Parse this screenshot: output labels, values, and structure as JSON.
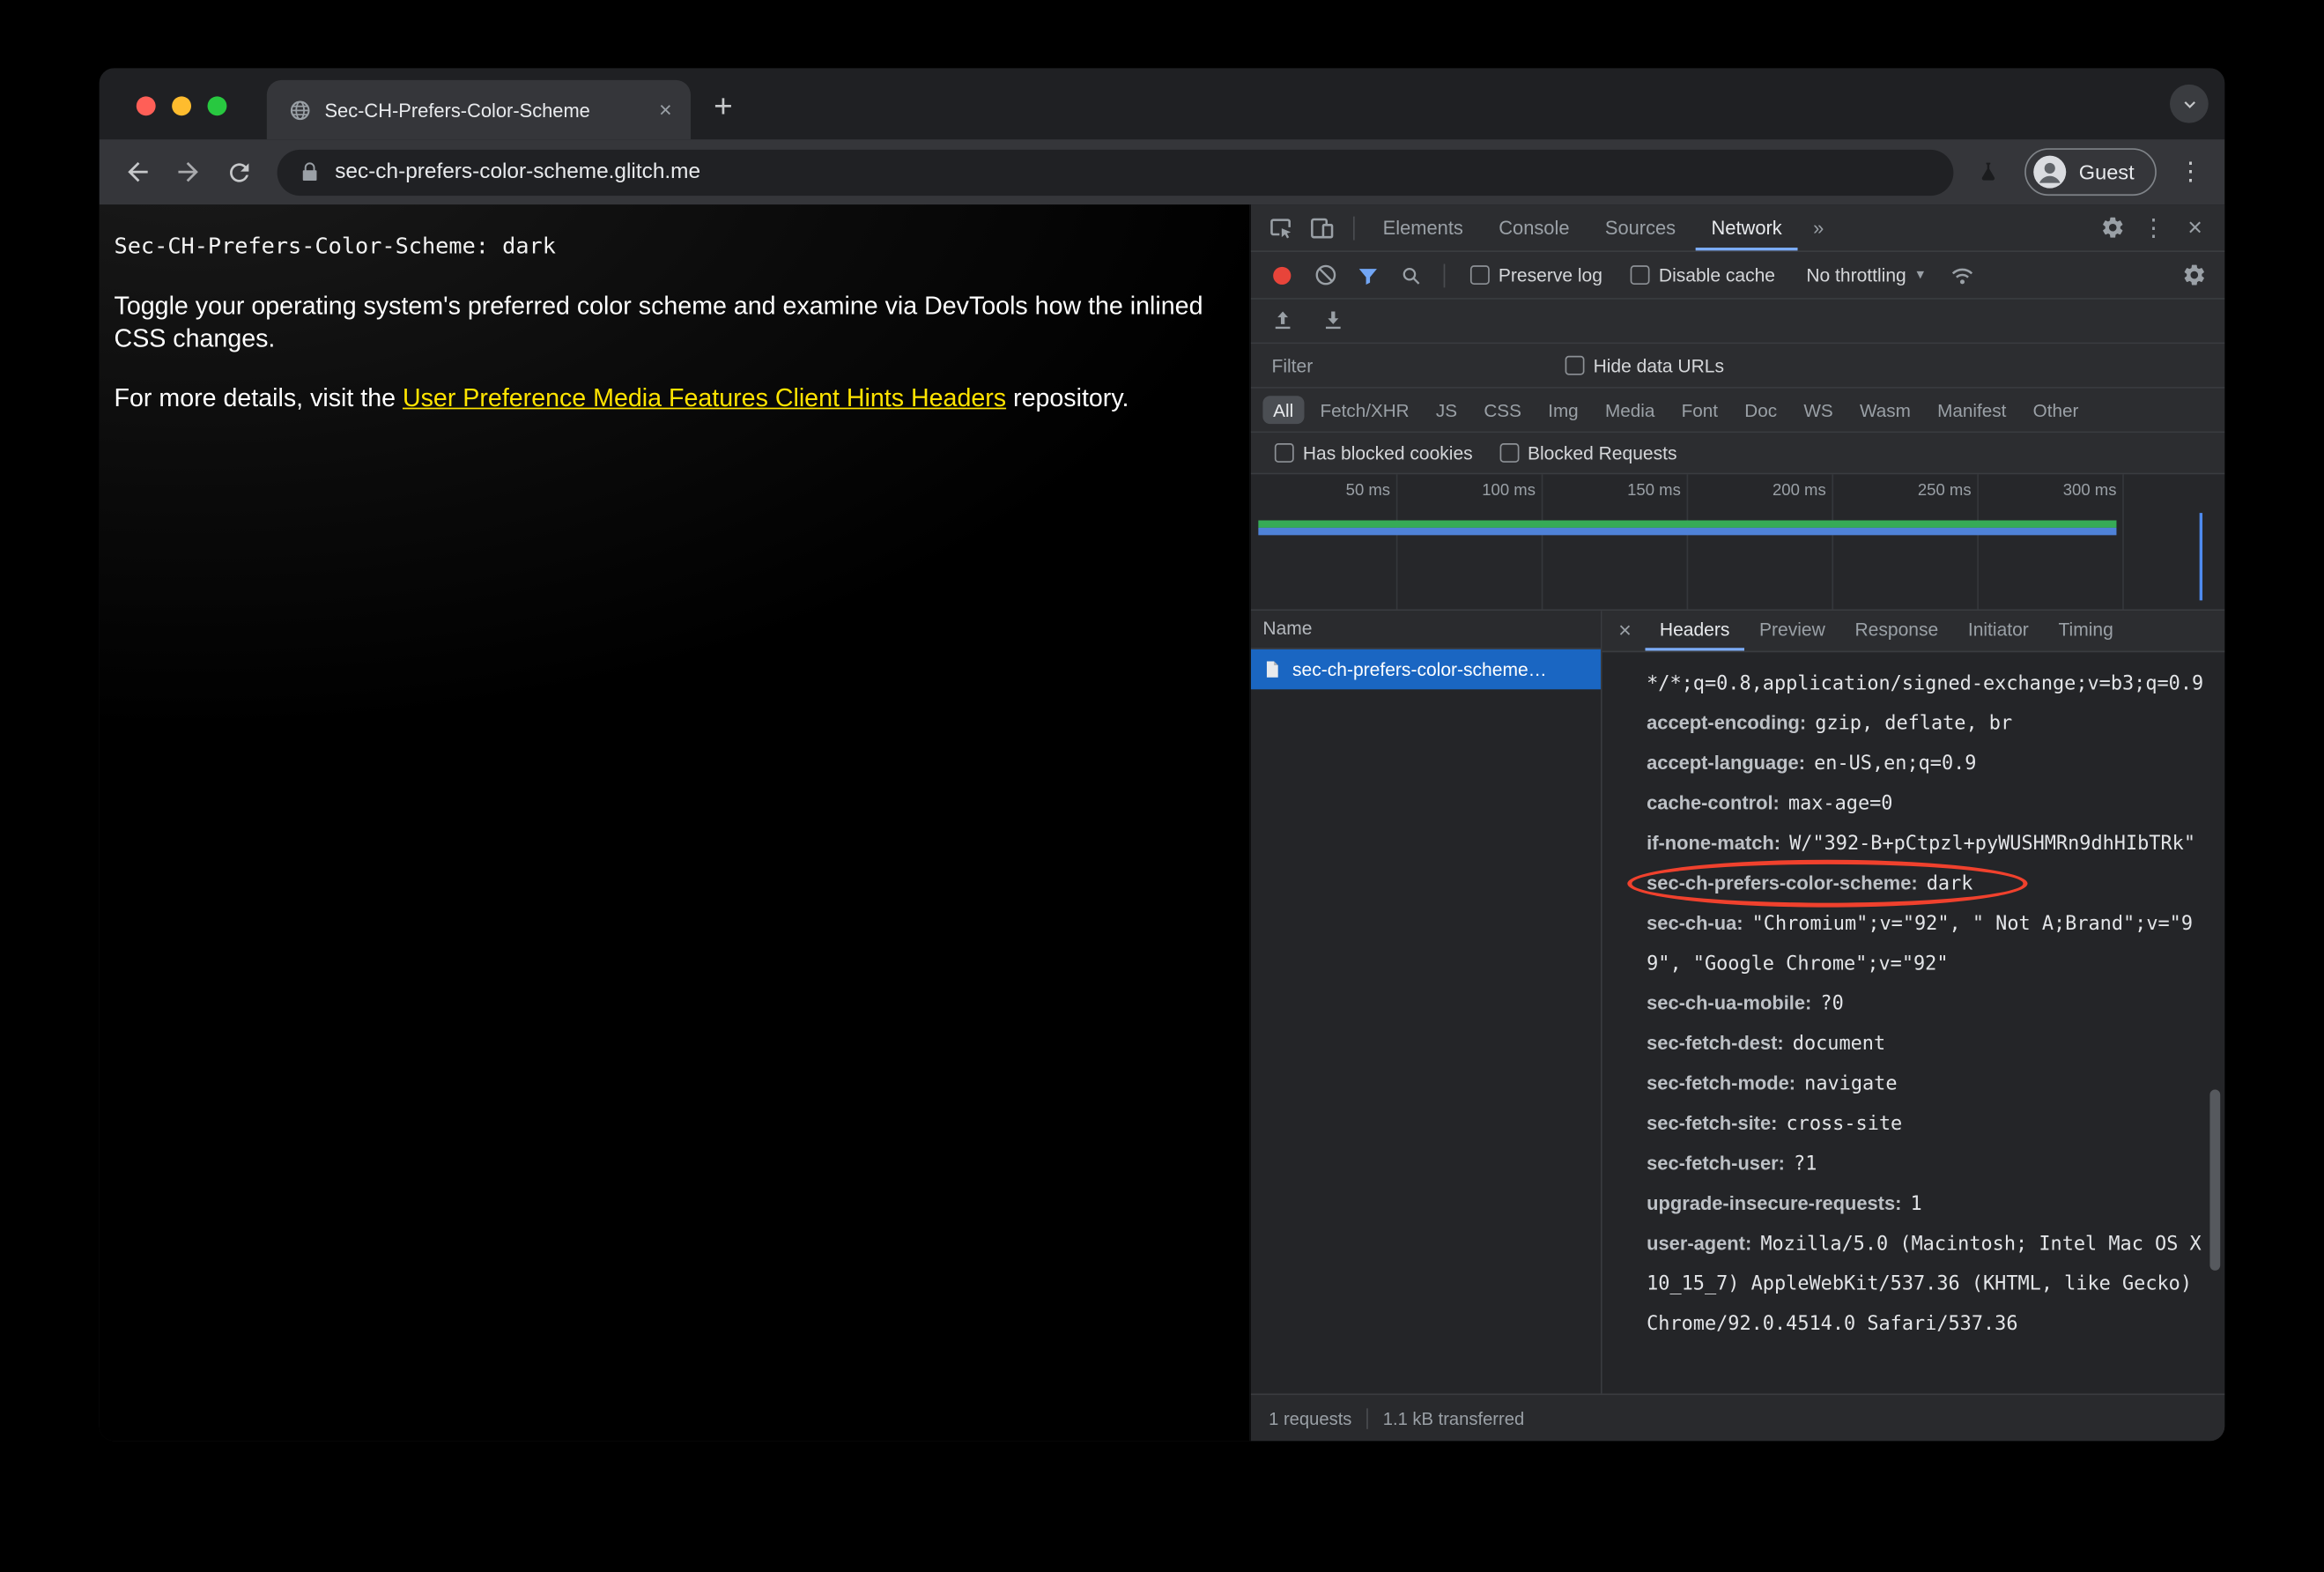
{
  "colors": {
    "accent_blue": "#7cacf8",
    "selection_blue": "#1a66c2",
    "record_red": "#e8443a",
    "annotation_red": "#f0412d",
    "link_yellow": "#ffe400",
    "timeline_green": "#36ab57",
    "timeline_blue": "#4f82d8"
  },
  "glyphs": {
    "close": "×",
    "menu": "⋮",
    "plus": "+",
    "more": "»",
    "dropdown_arrow": "▾"
  },
  "browser": {
    "tab_title": "Sec-CH-Prefers-Color-Scheme",
    "url": "sec-ch-prefers-color-scheme.glitch.me",
    "profile_label": "Guest"
  },
  "page": {
    "header_line": "Sec-CH-Prefers-Color-Scheme: dark",
    "paragraph1": "Toggle your operating system's preferred color scheme and examine via DevTools how the inlined CSS changes.",
    "paragraph2_prefix": "For more details, visit the ",
    "paragraph2_link": "User Preference Media Features Client Hints Headers",
    "paragraph2_suffix": " repository."
  },
  "devtools": {
    "main_tabs": [
      "Elements",
      "Console",
      "Sources",
      "Network"
    ],
    "toolbar": {
      "preserve_log": "Preserve log",
      "disable_cache": "Disable cache",
      "throttling": "No throttling"
    },
    "filter": {
      "placeholder": "Filter",
      "hide_data_urls": "Hide data URLs",
      "pills": [
        "All",
        "Fetch/XHR",
        "JS",
        "CSS",
        "Img",
        "Media",
        "Font",
        "Doc",
        "WS",
        "Wasm",
        "Manifest",
        "Other"
      ],
      "has_blocked_cookies": "Has blocked cookies",
      "blocked_requests": "Blocked Requests"
    },
    "timeline_labels": [
      "50 ms",
      "100 ms",
      "150 ms",
      "200 ms",
      "250 ms",
      "300 ms"
    ],
    "requests": {
      "name_header": "Name",
      "row_name": "sec-ch-prefers-color-scheme…"
    },
    "details_tabs": [
      "Headers",
      "Preview",
      "Response",
      "Initiator",
      "Timing"
    ],
    "request_headers": [
      {
        "name": "",
        "value": "*/*;q=0.8,application/signed-exchange;v=b3;q=0.9"
      },
      {
        "name": "accept-encoding:",
        "value": "gzip, deflate, br"
      },
      {
        "name": "accept-language:",
        "value": "en-US,en;q=0.9"
      },
      {
        "name": "cache-control:",
        "value": "max-age=0"
      },
      {
        "name": "if-none-match:",
        "value": "W/\"392-B+pCtpzl+pyWUSHMRn9dhHIbTRk\""
      },
      {
        "name": "sec-ch-prefers-color-scheme:",
        "value": "dark"
      },
      {
        "name": "sec-ch-ua:",
        "value": "\"Chromium\";v=\"92\", \" Not A;Brand\";v=\"99\", \"Google Chrome\";v=\"92\""
      },
      {
        "name": "sec-ch-ua-mobile:",
        "value": "?0"
      },
      {
        "name": "sec-fetch-dest:",
        "value": "document"
      },
      {
        "name": "sec-fetch-mode:",
        "value": "navigate"
      },
      {
        "name": "sec-fetch-site:",
        "value": "cross-site"
      },
      {
        "name": "sec-fetch-user:",
        "value": "?1"
      },
      {
        "name": "upgrade-insecure-requests:",
        "value": "1"
      },
      {
        "name": "user-agent:",
        "value": "Mozilla/5.0 (Macintosh; Intel Mac OS X 10_15_7) AppleWebKit/537.36 (KHTML, like Gecko) Chrome/92.0.4514.0 Safari/537.36"
      }
    ],
    "status": {
      "requests_count": "1 requests",
      "transferred": "1.1 kB transferred"
    }
  }
}
